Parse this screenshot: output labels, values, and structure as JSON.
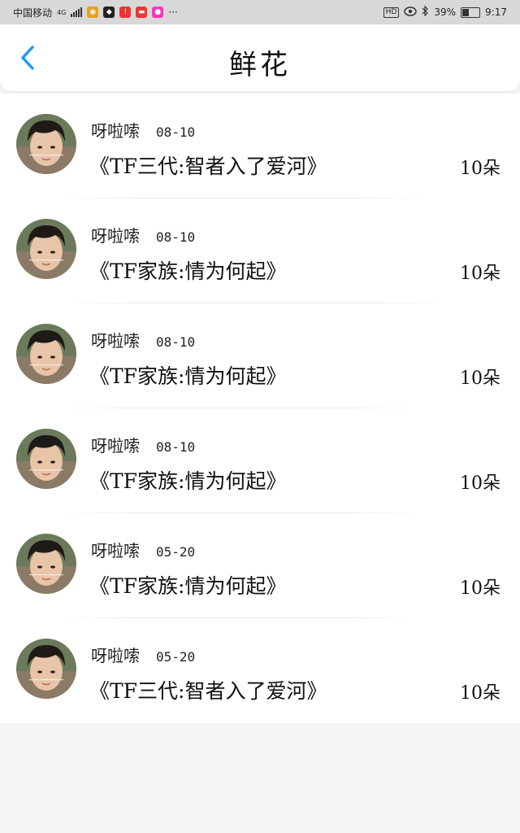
{
  "status_bar": {
    "carrier": "中国移动",
    "network": "4G",
    "battery": "39%",
    "time": "9:17",
    "hd": "HD",
    "more": "···",
    "battery_level": 0.39
  },
  "header": {
    "title": "鲜花",
    "accent_color": "#1e9bf0"
  },
  "list": {
    "items": [
      {
        "user": "呀啦嗦",
        "date": "08-10",
        "book": "《TF三代:智者入了爱河》",
        "count": "10朵"
      },
      {
        "user": "呀啦嗦",
        "date": "08-10",
        "book": "《TF家族:情为何起》",
        "count": "10朵"
      },
      {
        "user": "呀啦嗦",
        "date": "08-10",
        "book": "《TF家族:情为何起》",
        "count": "10朵"
      },
      {
        "user": "呀啦嗦",
        "date": "08-10",
        "book": "《TF家族:情为何起》",
        "count": "10朵"
      },
      {
        "user": "呀啦嗦",
        "date": "05-20",
        "book": "《TF家族:情为何起》",
        "count": "10朵"
      },
      {
        "user": "呀啦嗦",
        "date": "05-20",
        "book": "《TF三代:智者入了爱河》",
        "count": "10朵"
      }
    ]
  }
}
